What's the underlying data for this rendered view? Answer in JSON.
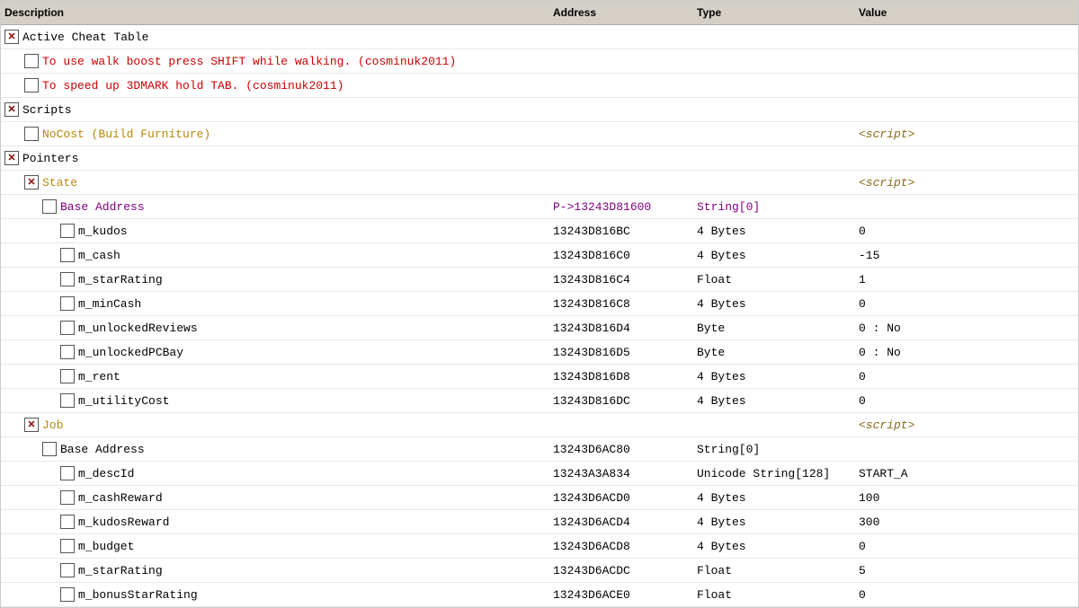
{
  "header": {
    "col_name": "Description",
    "col_addr": "Address",
    "col_type": "Type",
    "col_value": "Value"
  },
  "rows": [
    {
      "id": "active-cheat-table",
      "indent": 0,
      "checked": true,
      "label": "Active Cheat Table",
      "label_class": "label-normal",
      "addr": "",
      "type": "",
      "value": "",
      "script": false
    },
    {
      "id": "walk-boost",
      "indent": 1,
      "checked": false,
      "label": "To use walk boost press SHIFT while walking. (cosminuk2011)",
      "label_class": "label-red",
      "addr": "",
      "type": "",
      "value": "",
      "script": false
    },
    {
      "id": "speed-up-3dmark",
      "indent": 1,
      "checked": false,
      "label": "To speed up 3DMARK hold TAB. (cosminuk2011)",
      "label_class": "label-red",
      "addr": "",
      "type": "",
      "value": "",
      "script": false
    },
    {
      "id": "scripts",
      "indent": 0,
      "checked": true,
      "label": "Scripts",
      "label_class": "label-normal",
      "addr": "",
      "type": "",
      "value": "",
      "script": false
    },
    {
      "id": "no-cost",
      "indent": 1,
      "checked": false,
      "label": "NoCost (Build Furniture)",
      "label_class": "label-orange",
      "addr": "",
      "type": "",
      "value": "",
      "script": true,
      "script_label": "<script>"
    },
    {
      "id": "pointers",
      "indent": 0,
      "checked": true,
      "label": "Pointers",
      "label_class": "label-normal",
      "addr": "",
      "type": "",
      "value": "",
      "script": false
    },
    {
      "id": "state",
      "indent": 1,
      "checked": true,
      "label": "State",
      "label_class": "label-orange",
      "addr": "",
      "type": "",
      "value": "",
      "script": true,
      "script_label": "<script>"
    },
    {
      "id": "state-base-address",
      "indent": 2,
      "checked": false,
      "label": "Base Address",
      "label_class": "label-purple",
      "addr": "P->13243D81600",
      "addr_class": "label-purple",
      "type": "String[0]",
      "type_class": "label-purple",
      "value": "",
      "script": false
    },
    {
      "id": "m-kudos",
      "indent": 3,
      "checked": false,
      "label": "m_kudos",
      "label_class": "label-normal",
      "addr": "13243D816BC",
      "addr_class": "label-normal",
      "type": "4 Bytes",
      "type_class": "label-normal",
      "value": "0",
      "script": false
    },
    {
      "id": "m-cash",
      "indent": 3,
      "checked": false,
      "label": "m_cash",
      "label_class": "label-normal",
      "addr": "13243D816C0",
      "addr_class": "label-normal",
      "type": "4 Bytes",
      "type_class": "label-normal",
      "value": "-15",
      "script": false
    },
    {
      "id": "m-star-rating",
      "indent": 3,
      "checked": false,
      "label": "m_starRating",
      "label_class": "label-normal",
      "addr": "13243D816C4",
      "addr_class": "label-normal",
      "type": "Float",
      "type_class": "label-normal",
      "value": "1",
      "script": false
    },
    {
      "id": "m-min-cash",
      "indent": 3,
      "checked": false,
      "label": "m_minCash",
      "label_class": "label-normal",
      "addr": "13243D816C8",
      "addr_class": "label-normal",
      "type": "4 Bytes",
      "type_class": "label-normal",
      "value": "0",
      "script": false
    },
    {
      "id": "m-unlocked-reviews",
      "indent": 3,
      "checked": false,
      "label": "m_unlockedReviews",
      "label_class": "label-normal",
      "addr": "13243D816D4",
      "addr_class": "label-normal",
      "type": "Byte",
      "type_class": "label-normal",
      "value": "0 : No",
      "script": false
    },
    {
      "id": "m-unlocked-pcbay",
      "indent": 3,
      "checked": false,
      "label": "m_unlockedPCBay",
      "label_class": "label-normal",
      "addr": "13243D816D5",
      "addr_class": "label-normal",
      "type": "Byte",
      "type_class": "label-normal",
      "value": "0 : No",
      "script": false
    },
    {
      "id": "m-rent",
      "indent": 3,
      "checked": false,
      "label": "m_rent",
      "label_class": "label-normal",
      "addr": "13243D816D8",
      "addr_class": "label-normal",
      "type": "4 Bytes",
      "type_class": "label-normal",
      "value": "0",
      "script": false
    },
    {
      "id": "m-utility-cost",
      "indent": 3,
      "checked": false,
      "label": "m_utilityCost",
      "label_class": "label-normal",
      "addr": "13243D816DC",
      "addr_class": "label-normal",
      "type": "4 Bytes",
      "type_class": "label-normal",
      "value": "0",
      "script": false
    },
    {
      "id": "job",
      "indent": 1,
      "checked": true,
      "label": "Job",
      "label_class": "label-orange",
      "addr": "",
      "type": "",
      "value": "",
      "script": true,
      "script_label": "<script>"
    },
    {
      "id": "job-base-address",
      "indent": 2,
      "checked": false,
      "label": "Base Address",
      "label_class": "label-normal",
      "addr": "13243D6AC80",
      "addr_class": "label-normal",
      "type": "String[0]",
      "type_class": "label-normal",
      "value": "",
      "script": false
    },
    {
      "id": "m-desc-id",
      "indent": 3,
      "checked": false,
      "label": "m_descId",
      "label_class": "label-normal",
      "addr": "13243A3A834",
      "addr_class": "label-normal",
      "type": "Unicode String[128]",
      "type_class": "label-normal",
      "value": "START_A",
      "script": false
    },
    {
      "id": "m-cash-reward",
      "indent": 3,
      "checked": false,
      "label": "m_cashReward",
      "label_class": "label-normal",
      "addr": "13243D6ACD0",
      "addr_class": "label-normal",
      "type": "4 Bytes",
      "type_class": "label-normal",
      "value": "100",
      "script": false
    },
    {
      "id": "m-kudos-reward",
      "indent": 3,
      "checked": false,
      "label": "m_kudosReward",
      "label_class": "label-normal",
      "addr": "13243D6ACD4",
      "addr_class": "label-normal",
      "type": "4 Bytes",
      "type_class": "label-normal",
      "value": "300",
      "script": false
    },
    {
      "id": "m-budget",
      "indent": 3,
      "checked": false,
      "label": "m_budget",
      "label_class": "label-normal",
      "addr": "13243D6ACD8",
      "addr_class": "label-normal",
      "type": "4 Bytes",
      "type_class": "label-normal",
      "value": "0",
      "script": false
    },
    {
      "id": "m-star-rating-job",
      "indent": 3,
      "checked": false,
      "label": "m_starRating",
      "label_class": "label-normal",
      "addr": "13243D6ACDC",
      "addr_class": "label-normal",
      "type": "Float",
      "type_class": "label-normal",
      "value": "5",
      "script": false
    },
    {
      "id": "m-bonus-star-rating",
      "indent": 3,
      "checked": false,
      "label": "m_bonusStarRating",
      "label_class": "label-normal",
      "addr": "13243D6ACE0",
      "addr_class": "label-normal",
      "type": "Float",
      "type_class": "label-normal",
      "value": "0",
      "script": false
    }
  ]
}
